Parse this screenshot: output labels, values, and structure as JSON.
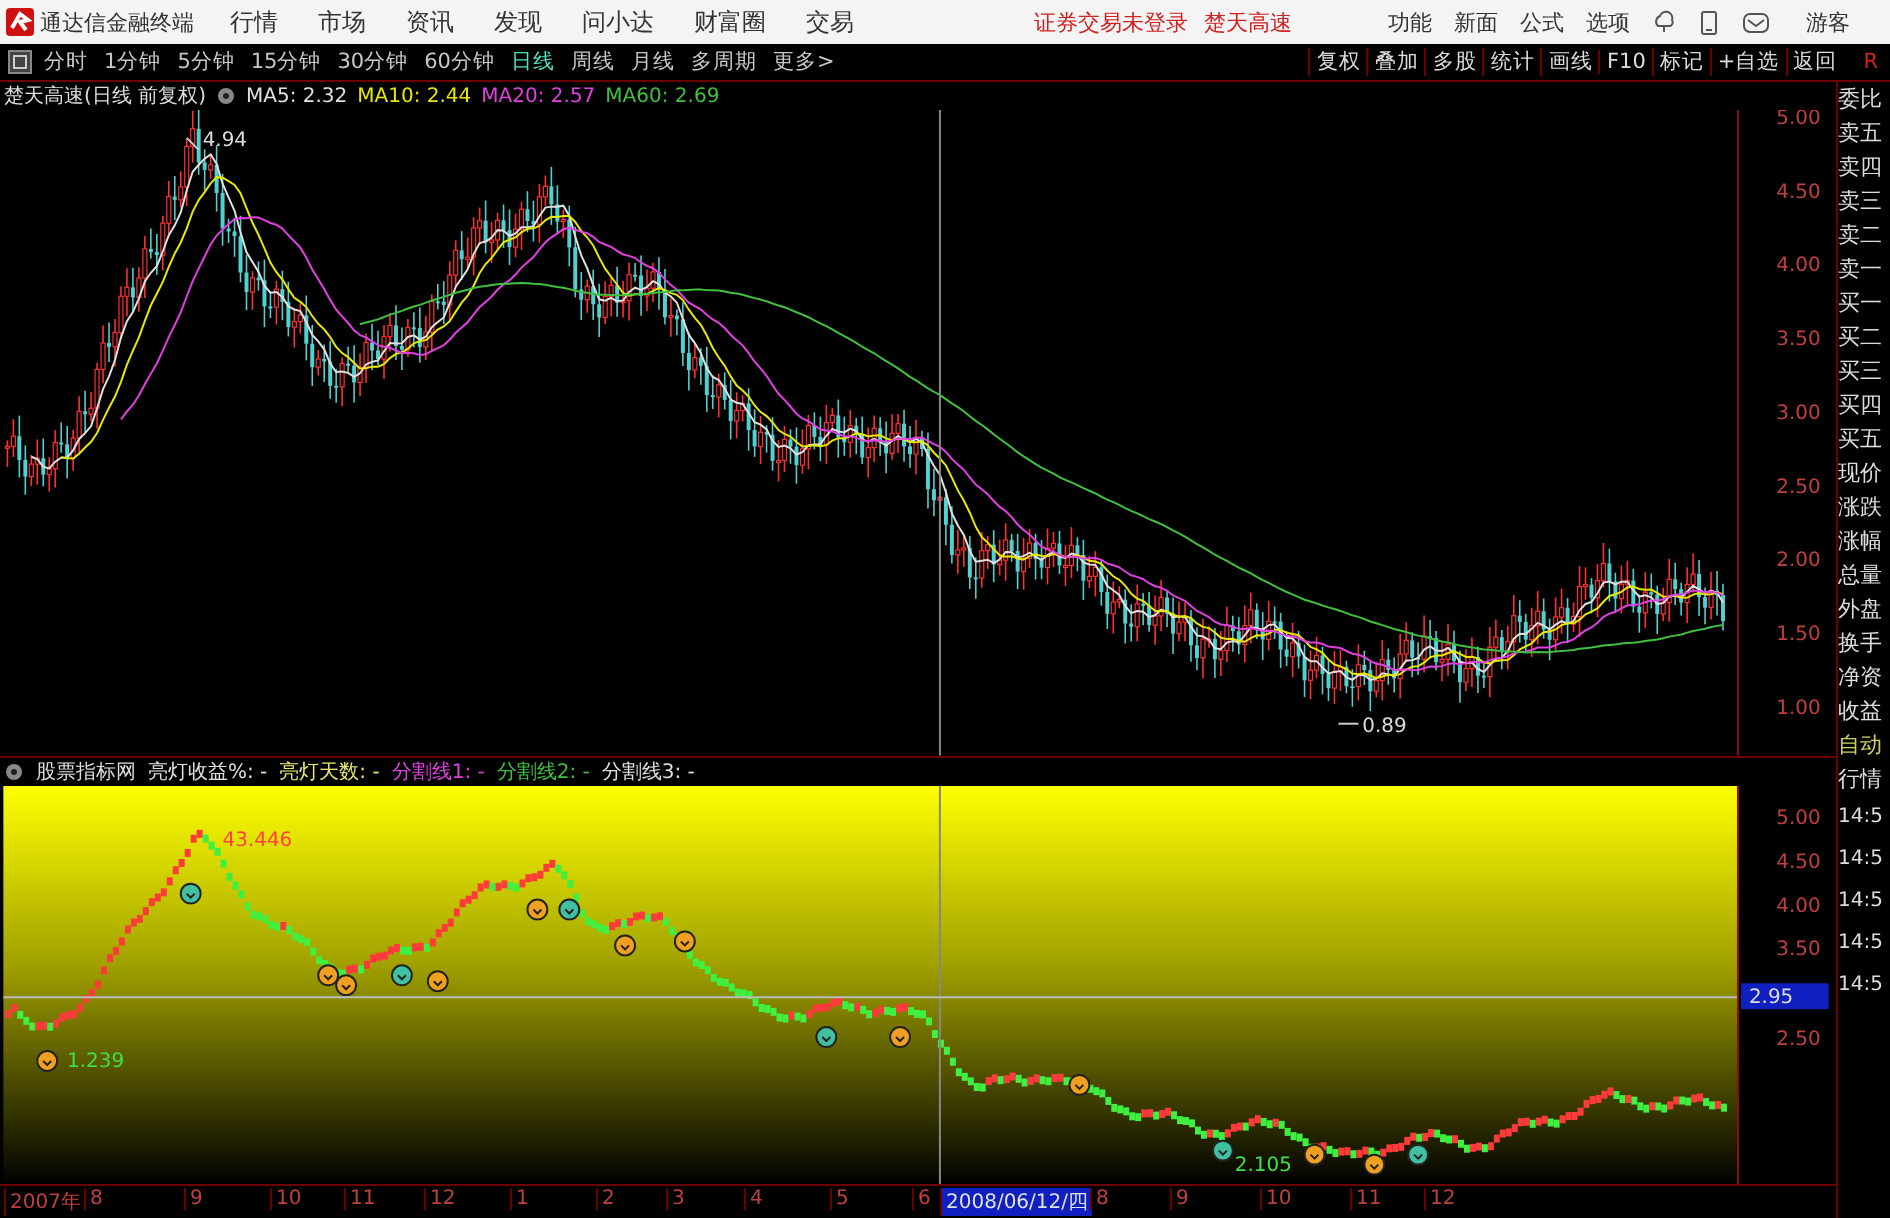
{
  "app": {
    "title": "通达信金融终端",
    "menu": [
      "行情",
      "市场",
      "资讯",
      "发现",
      "问小达",
      "财富圈",
      "交易"
    ],
    "status_texts": [
      "证券交易未登录",
      "楚天高速"
    ],
    "right_menu": [
      "功能",
      "新面",
      "公式",
      "选项"
    ],
    "user": "游客"
  },
  "toolbar": {
    "periods": [
      {
        "label": "分时",
        "selected": false
      },
      {
        "label": "1分钟",
        "selected": false
      },
      {
        "label": "5分钟",
        "selected": false
      },
      {
        "label": "15分钟",
        "selected": false
      },
      {
        "label": "30分钟",
        "selected": false
      },
      {
        "label": "60分钟",
        "selected": false
      },
      {
        "label": "日线",
        "selected": true
      },
      {
        "label": "周线",
        "selected": false
      },
      {
        "label": "月线",
        "selected": false
      },
      {
        "label": "多周期",
        "selected": false
      },
      {
        "label": "更多>",
        "selected": false
      }
    ],
    "tools": [
      "复权",
      "叠加",
      "多股",
      "统计",
      "画线",
      "F10",
      "标记",
      "+自选",
      "返回"
    ],
    "corner": "R"
  },
  "price_chart": {
    "title": "楚天高速(日线 前复权)",
    "ma": [
      {
        "label": "MA5: 2.32",
        "color": "#e0e0e0"
      },
      {
        "label": "MA10: 2.44",
        "color": "#e8e800"
      },
      {
        "label": "MA20: 2.57",
        "color": "#e040e0"
      },
      {
        "label": "MA60: 2.69",
        "color": "#40c040"
      }
    ],
    "high_label": "4.94",
    "low_label": "0.89",
    "axis": [
      "5.00",
      "4.50",
      "4.00",
      "3.50",
      "3.00",
      "2.50",
      "2.00",
      "1.50",
      "1.00"
    ]
  },
  "indicator": {
    "name": "股票指标网",
    "fields": [
      {
        "label": "亮灯收益%: -",
        "color": "#e0e0e0"
      },
      {
        "label": "亮灯天数: -",
        "color": "#e8e870"
      },
      {
        "label": "分割线1: -",
        "color": "#e040e0"
      },
      {
        "label": "分割线2: -",
        "color": "#40c040"
      },
      {
        "label": "分割线3: -",
        "color": "#e0e0e0"
      }
    ],
    "labels": [
      "43.446",
      "1.239",
      "2.105"
    ],
    "axis": [
      "5.00",
      "4.50",
      "4.00",
      "3.50",
      "2.50"
    ],
    "cursor_value": "2.95"
  },
  "time_axis": [
    {
      "label": "2007年",
      "selected": false
    },
    {
      "label": "8",
      "selected": false
    },
    {
      "label": "9",
      "selected": false
    },
    {
      "label": "10",
      "selected": false
    },
    {
      "label": "11",
      "selected": false
    },
    {
      "label": "12",
      "selected": false
    },
    {
      "label": "1",
      "selected": false
    },
    {
      "label": "2",
      "selected": false
    },
    {
      "label": "3",
      "selected": false
    },
    {
      "label": "4",
      "selected": false
    },
    {
      "label": "5",
      "selected": false
    },
    {
      "label": "6",
      "selected": false
    },
    {
      "label": "2008/06/12/四",
      "selected": true
    },
    {
      "label": "8",
      "selected": false
    },
    {
      "label": "9",
      "selected": false
    },
    {
      "label": "10",
      "selected": false
    },
    {
      "label": "11",
      "selected": false
    },
    {
      "label": "12",
      "selected": false
    }
  ],
  "quote_panel": {
    "fields": [
      "委比",
      "卖五",
      "卖四",
      "卖三",
      "卖二",
      "卖一",
      "买一",
      "买二",
      "买三",
      "买四",
      "买五",
      "现价",
      "涨跌",
      "涨幅",
      "总量",
      "外盘",
      "换手",
      "净资",
      "收益"
    ],
    "mode": [
      "自动",
      "行情"
    ],
    "times": [
      "14:5",
      "14:5",
      "14:5",
      "14:5",
      "14:5"
    ]
  }
}
